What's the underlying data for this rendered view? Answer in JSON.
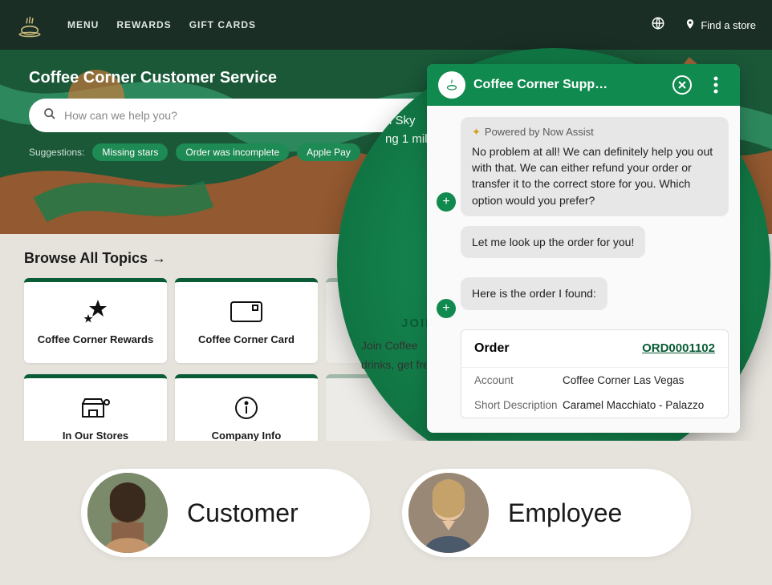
{
  "nav": {
    "links": [
      "MENU",
      "REWARDS",
      "GIFT CARDS"
    ],
    "find_store": "Find a store"
  },
  "hero": {
    "title": "Coffee Corner Customer Service",
    "search_placeholder": "How can we help you?",
    "sugg_label": "Suggestions:",
    "chips": [
      "Missing stars",
      "Order was incomplete",
      "Apple Pay"
    ]
  },
  "browse": {
    "title": "Browse All Topics →",
    "cards": [
      "Coffee Corner Rewards",
      "Coffee Corner Card",
      "",
      "In Our Stores",
      "Company Info",
      ""
    ]
  },
  "lens": {
    "line1": "d Sky",
    "line2": "ng 1 mil",
    "cta": "JOIN",
    "sub1": "Join Coffee",
    "sub2": "drinks, get fre"
  },
  "chat": {
    "title": "Coffee Corner Supp…",
    "badge": "Powered by Now Assist",
    "msg1": "No problem at all! We can definitely help you out with that. We can either refund your order or transfer it to the correct store for you. Which option would you prefer?",
    "msg2": "Let me look up the order for you!",
    "msg3": "Here is the order I found:",
    "order": {
      "title": "Order",
      "number": "ORD0001102",
      "account_k": "Account",
      "account_v": "Coffee Corner Las Vegas",
      "desc_k": "Short Description",
      "desc_v": "Caramel Macchiato - Palazzo"
    }
  },
  "personas": {
    "a": "Customer",
    "b": "Employee"
  }
}
